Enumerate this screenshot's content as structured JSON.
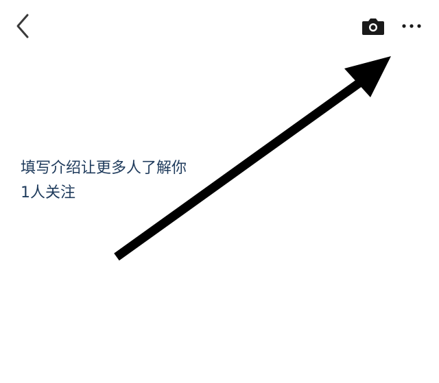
{
  "header": {
    "back_icon": "chevron-left-icon",
    "camera_icon": "camera-icon",
    "more_icon": "more-horizontal-icon"
  },
  "profile": {
    "intro_prompt": "填写介绍让更多人了解你",
    "followers_text": "1人关注"
  },
  "annotation": {
    "arrow_color": "#000000"
  },
  "colors": {
    "text_link": "#1f3b5c",
    "icon": "#3a3a3a",
    "background": "#ffffff"
  }
}
